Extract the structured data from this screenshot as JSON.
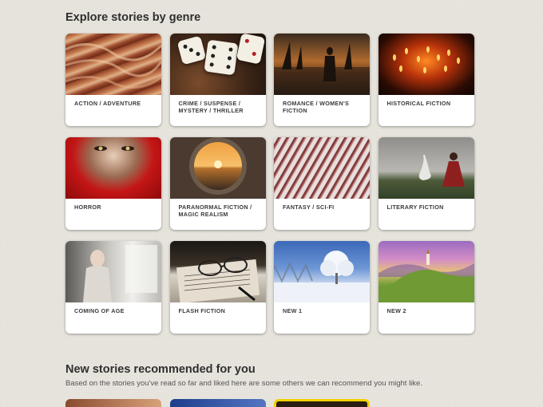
{
  "genres_section": {
    "title": "Explore stories by genre",
    "cards": [
      {
        "label": "ACTION / ADVENTURE",
        "thumb": "canyon-rock-waves"
      },
      {
        "label": "CRIME / SUSPENSE / MYSTERY / THRILLER",
        "thumb": "dice-on-leopard-print"
      },
      {
        "label": "ROMANCE / WOMEN'S FICTION",
        "thumb": "woman-harbor-sunset"
      },
      {
        "label": "HISTORICAL FICTION",
        "thumb": "candles-dark"
      },
      {
        "label": "HORROR",
        "thumb": "face-red-hood"
      },
      {
        "label": "PARANORMAL FICTION / MAGIC REALISM",
        "thumb": "porthole-sunset"
      },
      {
        "label": "FANTASY / SCI-FI",
        "thumb": "red-berries-branches"
      },
      {
        "label": "LITERARY FICTION",
        "thumb": "woman-with-goose"
      },
      {
        "label": "COMING OF AGE",
        "thumb": "girl-by-window"
      },
      {
        "label": "FLASH FICTION",
        "thumb": "glasses-on-letter"
      },
      {
        "label": "NEW 1",
        "thumb": "snowy-tree"
      },
      {
        "label": "NEW 2",
        "thumb": "hill-church-landscape"
      }
    ]
  },
  "recommended_section": {
    "title": "New stories recommended for you",
    "subtitle": "Based on the stories you've read so far and liked here are some others we can recommend you might like."
  }
}
